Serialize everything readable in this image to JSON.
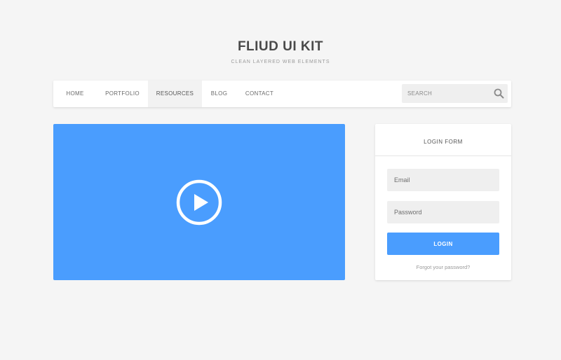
{
  "header": {
    "title": "FLIUD UI KIT",
    "subtitle": "CLEAN LAYERED WEB ELEMENTS"
  },
  "nav": {
    "items": [
      {
        "label": "HOME",
        "active": false
      },
      {
        "label": "PORTFOLIO",
        "active": false
      },
      {
        "label": "RESOURCES",
        "active": true
      },
      {
        "label": "BLOG",
        "active": false
      },
      {
        "label": "CONTACT",
        "active": false
      }
    ],
    "search": {
      "placeholder": "SEARCH",
      "icon": "search-icon"
    }
  },
  "video": {
    "icon": "play-icon",
    "color": "#4a9dfe"
  },
  "login": {
    "title": "LOGIN FORM",
    "email_placeholder": "Email",
    "password_placeholder": "Password",
    "button_label": "LOGIN",
    "forgot_link": "Forgot your password?",
    "accent": "#4a9dfe"
  }
}
